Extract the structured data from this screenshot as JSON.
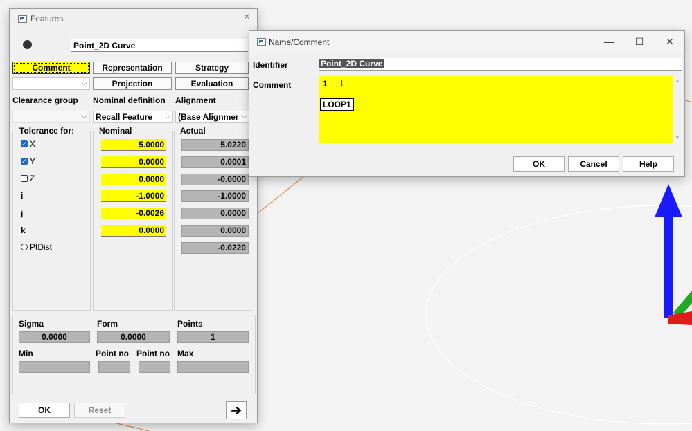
{
  "features_window": {
    "title": "Features",
    "close_glyph": "×",
    "feature_name": "Point_2D Curve",
    "tabs": {
      "comment": "Comment",
      "representation": "Representation",
      "strategy": "Strategy",
      "projection": "Projection",
      "evaluation": "Evaluation"
    },
    "labels": {
      "clearance_group": "Clearance group",
      "nominal_definition": "Nominal definition",
      "alignment": "Alignment"
    },
    "dropdowns": {
      "nominal_definition": "Recall Feature",
      "alignment": "(Base Alignmer"
    },
    "columns": {
      "tolerance_for": "Tolerance for:",
      "nominal": "Nominal",
      "actual": "Actual"
    },
    "rows": [
      {
        "label": "X",
        "checked": true,
        "nominal": "5.0000",
        "actual": "5.0220"
      },
      {
        "label": "Y",
        "checked": true,
        "nominal": "0.0000",
        "actual": "0.0001"
      },
      {
        "label": "Z",
        "checked": false,
        "nominal": "0.0000",
        "actual": "-0.0000"
      },
      {
        "label": "i",
        "nominal": "-1.0000",
        "actual": "-1.0000"
      },
      {
        "label": "j",
        "nominal": "-0.0026",
        "actual": "0.0000"
      },
      {
        "label": "k",
        "nominal": "0.0000",
        "actual": "0.0000"
      }
    ],
    "ptdist": {
      "label": "PtDist",
      "checked": false,
      "actual": "-0.0220"
    },
    "stats": {
      "sigma_label": "Sigma",
      "sigma": "0.0000",
      "form_label": "Form",
      "form": "0.0000",
      "points_label": "Points",
      "points": "1",
      "min_label": "Min",
      "point_no_label": "Point no",
      "max_label": "Max"
    },
    "buttons": {
      "ok": "OK",
      "reset": "Reset"
    },
    "arrow_glyph": "➔"
  },
  "name_comment_dialog": {
    "title": "Name/Comment",
    "controls": {
      "minimize": "—",
      "maximize": "☐",
      "close": "✕"
    },
    "identifier_label": "Identifier",
    "identifier_value": "Point_2D Curve",
    "comment_label": "Comment",
    "comment_line1": "1",
    "comment_tag": "LOOP1",
    "cursor_glyph": "I",
    "buttons": {
      "ok": "OK",
      "cancel": "Cancel",
      "help": "Help"
    }
  },
  "colors": {
    "field_yellow": "#ffff00",
    "readonly_gray": "#b5b5b5",
    "axis_blue": "#1a1aff",
    "axis_green": "#1faa1f",
    "axis_red": "#e01b1b",
    "curve_orange": "#e07a30"
  }
}
